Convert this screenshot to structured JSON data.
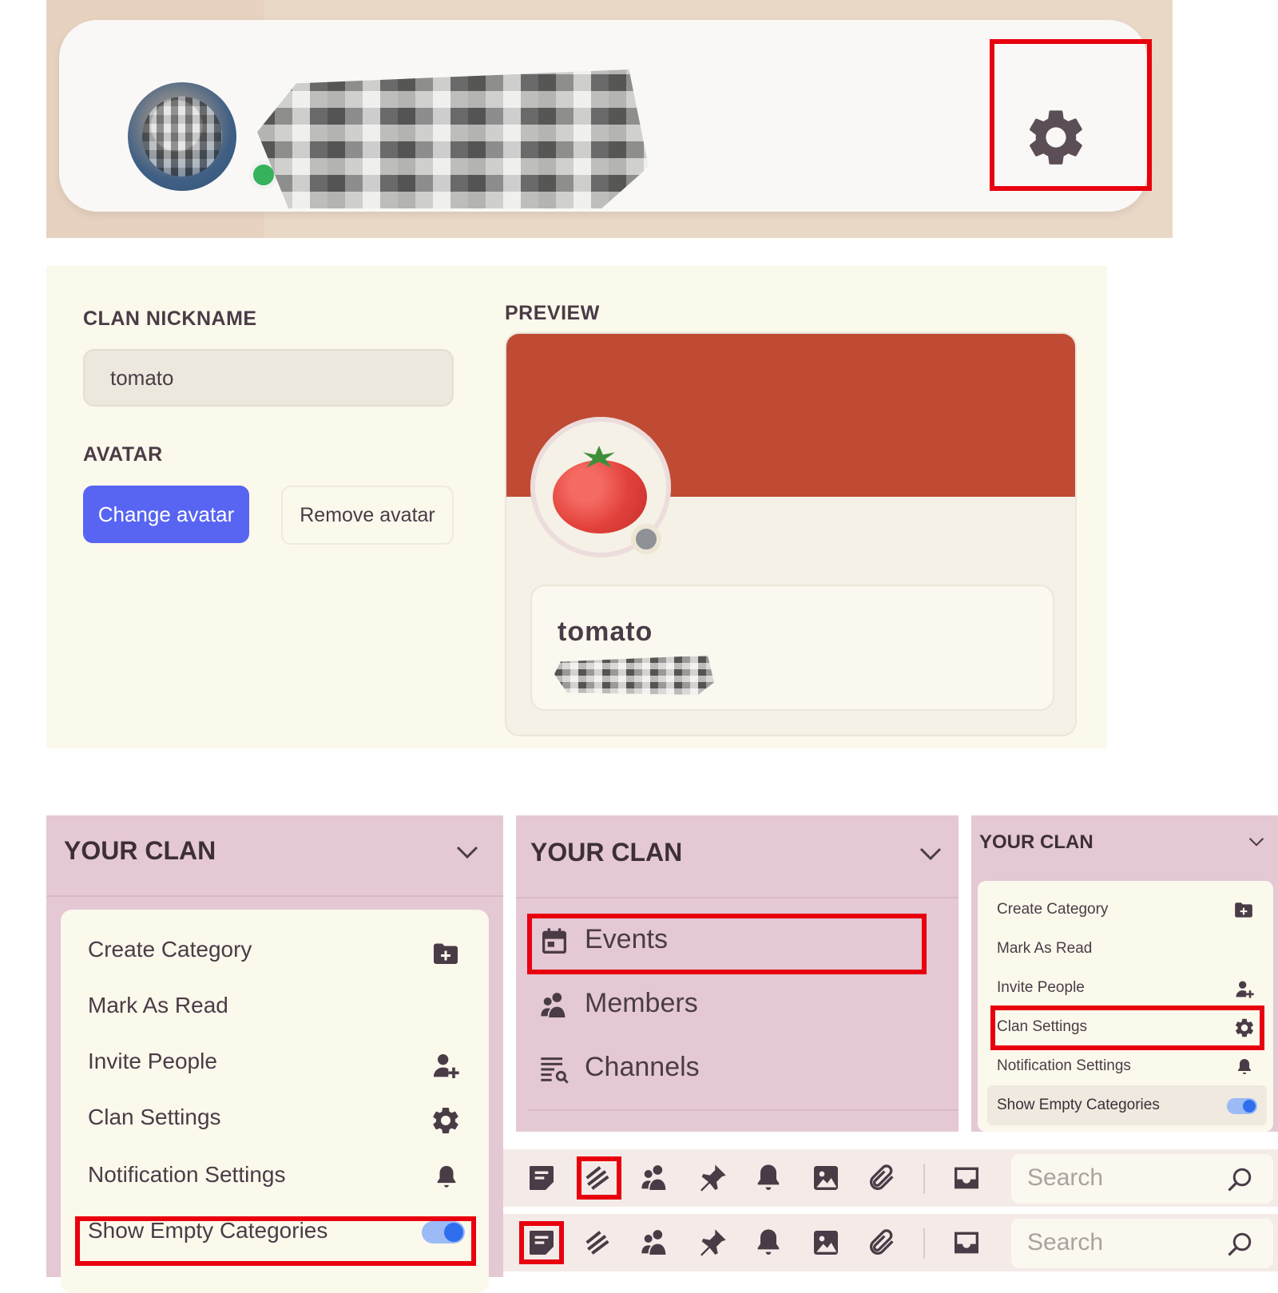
{
  "clan_settings": {
    "nickname_label": "CLAN NICKNAME",
    "nickname_value": "tomato",
    "avatar_label": "AVATAR",
    "change_avatar": "Change avatar",
    "remove_avatar": "Remove avatar",
    "preview_label": "PREVIEW",
    "preview_name": "tomato"
  },
  "clan_menu": {
    "title": "YOUR CLAN",
    "items": [
      {
        "label": "Create Category",
        "icon": "folder-plus-icon"
      },
      {
        "label": "Mark As Read",
        "icon": ""
      },
      {
        "label": "Invite People",
        "icon": "user-plus-icon"
      },
      {
        "label": "Clan Settings",
        "icon": "gear-icon"
      },
      {
        "label": "Notification Settings",
        "icon": "bell-icon"
      },
      {
        "label": "Show Empty Categories",
        "icon": "toggle-on"
      }
    ]
  },
  "clan_nav": {
    "title": "YOUR CLAN",
    "items": [
      {
        "label": "Events",
        "icon": "calendar-icon"
      },
      {
        "label": "Members",
        "icon": "members-icon"
      },
      {
        "label": "Channels",
        "icon": "channel-list-icon"
      }
    ]
  },
  "toolbar": {
    "search_placeholder": "Search",
    "icons": [
      "note-icon",
      "threads-icon",
      "members-icon",
      "pin-icon",
      "bell-icon",
      "image-icon",
      "attachment-icon",
      "inbox-icon",
      "search-icon"
    ]
  },
  "colors": {
    "highlight": "#e8000e",
    "accent": "#5865f2",
    "banner": "#c04b34",
    "clan_bg": "#e4c8d4"
  }
}
